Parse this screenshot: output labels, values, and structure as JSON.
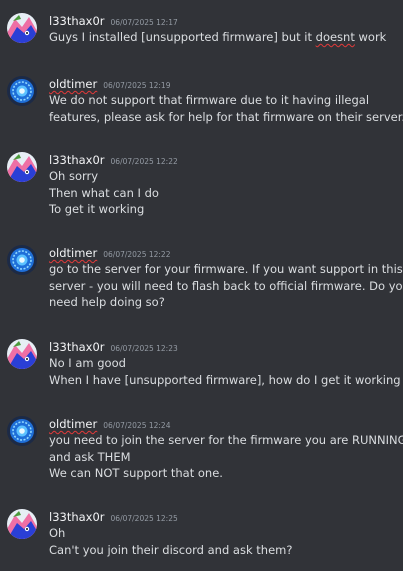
{
  "messages": [
    {
      "author": "l33thax0r",
      "timestamp": "06/07/2025 12:17",
      "avatar": "pink-blue-cartoon-avatar",
      "lines": [
        [
          "Guys I installed [unsupported firmware] but it ",
          "doesnt",
          " work"
        ]
      ]
    },
    {
      "author": "oldtimer",
      "timestamp": "06/07/2025 12:19",
      "avatar": "blue-orb-avatar",
      "lines": [
        [
          "We do not support that firmware due to it having illegal"
        ],
        [
          "features, please ask for help for that firmware on their server."
        ]
      ]
    },
    {
      "author": "l33thax0r",
      "timestamp": "06/07/2025 12:22",
      "avatar": "pink-blue-cartoon-avatar",
      "lines": [
        [
          "Oh sorry"
        ],
        [
          "Then what can I do"
        ],
        [
          "To get it working"
        ]
      ]
    },
    {
      "author": "oldtimer",
      "timestamp": "06/07/2025 12:22",
      "avatar": "blue-orb-avatar",
      "lines": [
        [
          "go to the server for your firmware. If you want support in this"
        ],
        [
          "server - you will need to flash back to official firmware. Do you"
        ],
        [
          "need help doing so?"
        ]
      ]
    },
    {
      "author": "l33thax0r",
      "timestamp": "06/07/2025 12:23",
      "avatar": "pink-blue-cartoon-avatar",
      "lines": [
        [
          "No I am good"
        ],
        [
          "When I have [unsupported firmware], how do I get it working"
        ]
      ]
    },
    {
      "author": "oldtimer",
      "timestamp": "06/07/2025 12:24",
      "avatar": "blue-orb-avatar",
      "lines": [
        [
          "you need to join the server for the firmware you are RUNNING"
        ],
        [
          "and ask THEM"
        ],
        [
          "We can NOT support that one."
        ]
      ]
    },
    {
      "author": "l33thax0r",
      "timestamp": "06/07/2025 12:25",
      "avatar": "pink-blue-cartoon-avatar",
      "lines": [
        [
          "Oh"
        ],
        [
          "Can't you join their discord and ask them?"
        ]
      ]
    }
  ],
  "colors": {
    "background": "#313338",
    "username": "#f2f3f5",
    "timestamp": "#949ba4",
    "text": "#dbdee1",
    "spellcheck": "#e23a3a"
  }
}
